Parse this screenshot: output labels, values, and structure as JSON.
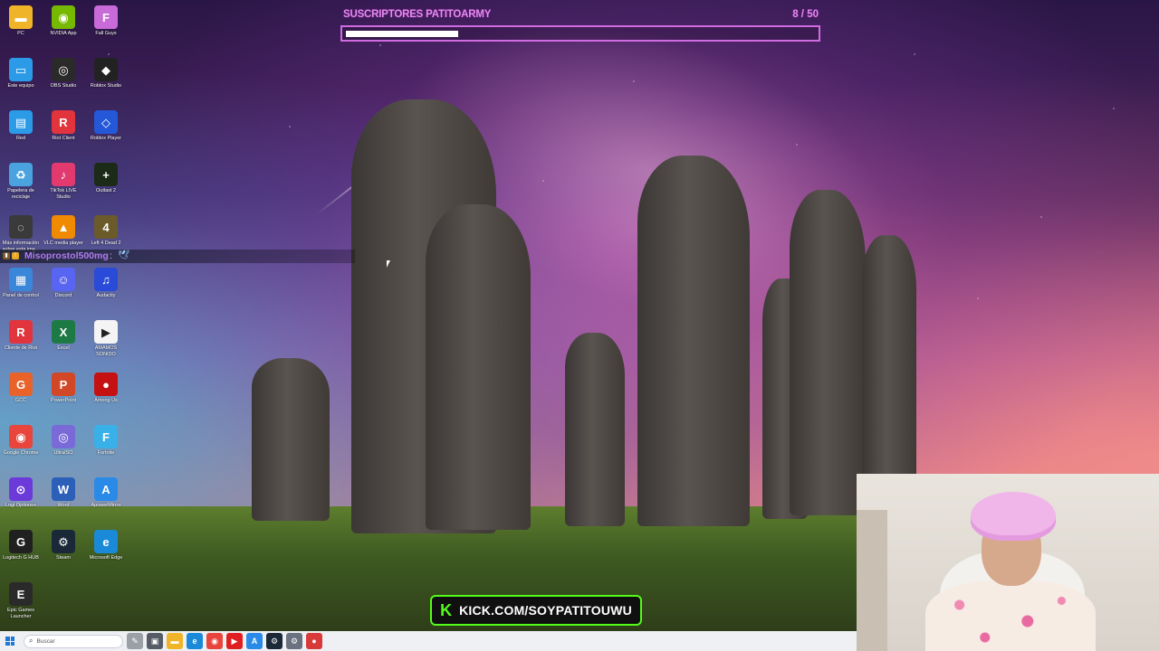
{
  "colors": {
    "overlay_accent": "#e48cf0",
    "kick_green": "#53fc18",
    "chat_username": "#b07cf0"
  },
  "subscriber_goal": {
    "title": "SUSCRIPTORES PATITOARMY",
    "count_text": "8 / 50",
    "current": 8,
    "goal": 50,
    "progress_fraction": 0.16
  },
  "chat": {
    "username": "Misoprostol500mg",
    "separator": ":",
    "badge_icons": [
      "sub-badge-icon",
      "alert-badge-icon"
    ],
    "emote_icon": "bird-emote-icon"
  },
  "stream_banner": {
    "logo_letter": "K",
    "text": "KICK.COM/SOYPATITOUWU"
  },
  "desktop_icons": [
    {
      "label": "PC",
      "icon": "folder-icon",
      "color": "#f0b429",
      "glyph": "▬"
    },
    {
      "label": "NVIDIA App",
      "icon": "nvidia-icon",
      "color": "#76b900",
      "glyph": "◉"
    },
    {
      "label": "Fall Guys",
      "icon": "fall-guys-icon",
      "color": "#c86ad8",
      "glyph": "F"
    },
    {
      "label": "Este equipo",
      "icon": "monitor-icon",
      "color": "#2b9be8",
      "glyph": "▭"
    },
    {
      "label": "OBS Studio",
      "icon": "obs-icon",
      "color": "#2a2a2a",
      "glyph": "◎"
    },
    {
      "label": "Roblox Studio",
      "icon": "roblox-studio-icon",
      "color": "#222222",
      "glyph": "◆"
    },
    {
      "label": "Red",
      "icon": "network-icon",
      "color": "#2b9be8",
      "glyph": "▤"
    },
    {
      "label": "Riot Client",
      "icon": "riot-client-icon",
      "color": "#e2343c",
      "glyph": "R"
    },
    {
      "label": "Roblox Player",
      "icon": "roblox-player-icon",
      "color": "#2458d8",
      "glyph": "◇"
    },
    {
      "label": "Papelera de reciclaje",
      "icon": "recycle-bin-icon",
      "color": "#4aa3df",
      "glyph": "♻"
    },
    {
      "label": "TikTok LIVE Studio",
      "icon": "tiktok-icon",
      "color": "#e23a6e",
      "glyph": "♪"
    },
    {
      "label": "Outlast 2",
      "icon": "outlast-icon",
      "color": "#1c2a18",
      "glyph": "+"
    },
    {
      "label": "Más información sobre esta ima...",
      "icon": "info-icon",
      "color": "#3a3a3a",
      "glyph": "◌"
    },
    {
      "label": "VLC media player",
      "icon": "vlc-icon",
      "color": "#f08a00",
      "glyph": "▲"
    },
    {
      "label": "Left 4 Dead 2",
      "icon": "left4dead-icon",
      "color": "#6b5a2a",
      "glyph": "4"
    },
    {
      "label": "Panel de control",
      "icon": "control-panel-icon",
      "color": "#3a86d8",
      "glyph": "▦"
    },
    {
      "label": "Discord",
      "icon": "discord-icon",
      "color": "#5865f2",
      "glyph": "☺"
    },
    {
      "label": "Audacity",
      "icon": "audacity-icon",
      "color": "#2a4ad8",
      "glyph": "♫"
    },
    {
      "label": "Cliente de Riot",
      "icon": "riot-client-alt-icon",
      "color": "#e2343c",
      "glyph": "R"
    },
    {
      "label": "Excel",
      "icon": "excel-icon",
      "color": "#1d7a45",
      "glyph": "X"
    },
    {
      "label": "AMAMOS SONIDO",
      "icon": "media-file-icon",
      "color": "#f4f4f4",
      "glyph": "▶"
    },
    {
      "label": "GCC",
      "icon": "gcc-icon",
      "color": "#e8622a",
      "glyph": "G"
    },
    {
      "label": "PowerPoint",
      "icon": "powerpoint-icon",
      "color": "#d24726",
      "glyph": "P"
    },
    {
      "label": "Among Us",
      "icon": "among-us-icon",
      "color": "#c51111",
      "glyph": "●"
    },
    {
      "label": "Google Chrome",
      "icon": "chrome-icon",
      "color": "#e8453c",
      "glyph": "◉"
    },
    {
      "label": "UltraISO",
      "icon": "ultraiso-icon",
      "color": "#7a6ad8",
      "glyph": "◎"
    },
    {
      "label": "Fortnite",
      "icon": "fortnite-icon",
      "color": "#3ab0e8",
      "glyph": "F"
    },
    {
      "label": "Logi Options+",
      "icon": "logi-options-icon",
      "color": "#6b3ad8",
      "glyph": "⊙"
    },
    {
      "label": "Word",
      "icon": "word-icon",
      "color": "#2b5fb8",
      "glyph": "W"
    },
    {
      "label": "ApowerMirror",
      "icon": "apowermirror-icon",
      "color": "#2a8ae8",
      "glyph": "A"
    },
    {
      "label": "Logitech G HUB",
      "icon": "logitech-ghub-icon",
      "color": "#202020",
      "glyph": "G"
    },
    {
      "label": "Steam",
      "icon": "steam-icon",
      "color": "#1b2838",
      "glyph": "⚙"
    },
    {
      "label": "Microsoft Edge",
      "icon": "edge-icon",
      "color": "#1a8ad8",
      "glyph": "e"
    },
    {
      "label": "Epic Games Launcher",
      "icon": "epic-games-icon",
      "color": "#2a2a2a",
      "glyph": "E"
    }
  ],
  "taskbar": {
    "search_placeholder": "Buscar",
    "apps": [
      {
        "icon": "pen-app-icon",
        "color": "#9aa0a8",
        "glyph": "✎"
      },
      {
        "icon": "task-view-icon",
        "color": "#555c66",
        "glyph": "▣"
      },
      {
        "icon": "file-explorer-icon",
        "color": "#f0b429",
        "glyph": "▬"
      },
      {
        "icon": "edge-taskbar-icon",
        "color": "#1a8ad8",
        "glyph": "e"
      },
      {
        "icon": "chrome-taskbar-icon",
        "color": "#e8453c",
        "glyph": "◉"
      },
      {
        "icon": "youtube-taskbar-icon",
        "color": "#e02020",
        "glyph": "▶"
      },
      {
        "icon": "apowermirror-taskbar-icon",
        "color": "#2a8ae8",
        "glyph": "A"
      },
      {
        "icon": "steam-taskbar-icon",
        "color": "#1b2838",
        "glyph": "⚙"
      },
      {
        "icon": "settings-taskbar-icon",
        "color": "#6a7280",
        "glyph": "⚙"
      },
      {
        "icon": "game-taskbar-icon",
        "color": "#d83a3a",
        "glyph": "●"
      }
    ]
  }
}
